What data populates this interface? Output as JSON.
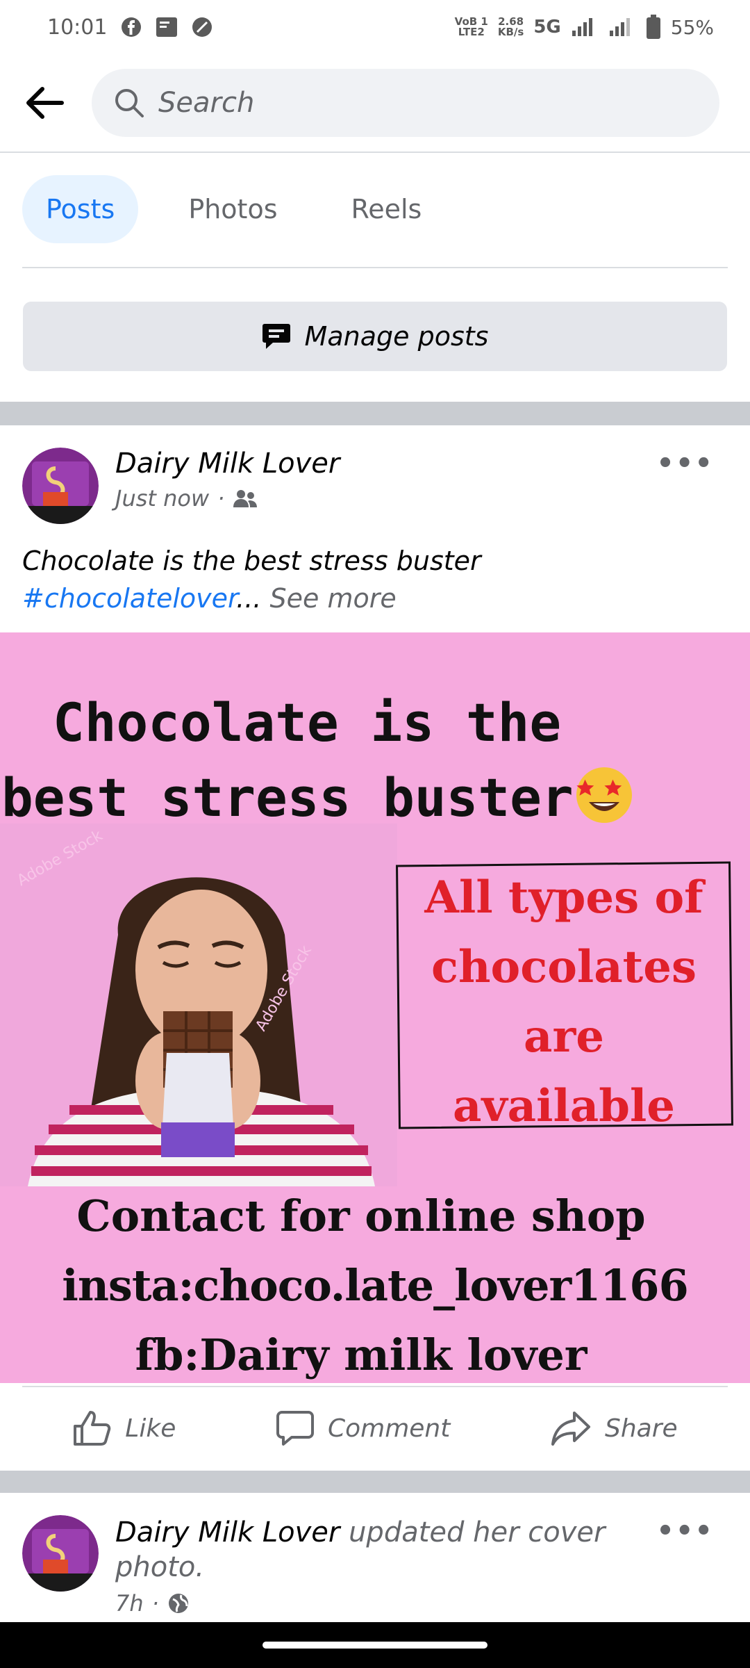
{
  "status_bar": {
    "time": "10:01",
    "network_top": "VoB 1",
    "network_bottom": "LTE2",
    "speed_top": "2.68",
    "speed_bottom": "KB/s",
    "network_type": "5G",
    "battery": "55%"
  },
  "search": {
    "placeholder": "Search"
  },
  "tabs": [
    {
      "label": "Posts",
      "active": true
    },
    {
      "label": "Photos",
      "active": false
    },
    {
      "label": "Reels",
      "active": false
    }
  ],
  "manage_posts": {
    "label": "Manage posts"
  },
  "post": {
    "author": "Dairy Milk Lover",
    "time": "Just now",
    "text": "Chocolate is the best stress buster",
    "hashtag": "#chocolatelover",
    "ellipsis": "...",
    "see_more": "See more",
    "image": {
      "title_line1": "Chocolate is the",
      "title_line2": "best stress buster",
      "box_line1": "All types of",
      "box_line2": "chocolates",
      "box_line3": "are",
      "box_line4": "available",
      "contact_line1": "Contact for online shop",
      "contact_line2": "insta:choco.late_lover1166",
      "contact_line3": "fb:Dairy milk lover"
    },
    "actions": {
      "like": "Like",
      "comment": "Comment",
      "share": "Share"
    }
  },
  "post2": {
    "author": "Dairy Milk Lover",
    "action_text": "updated her cover photo.",
    "time": "7h"
  },
  "colors": {
    "accent": "#1877f2",
    "image_bg": "#f6aade",
    "box_text": "#e0202a"
  }
}
